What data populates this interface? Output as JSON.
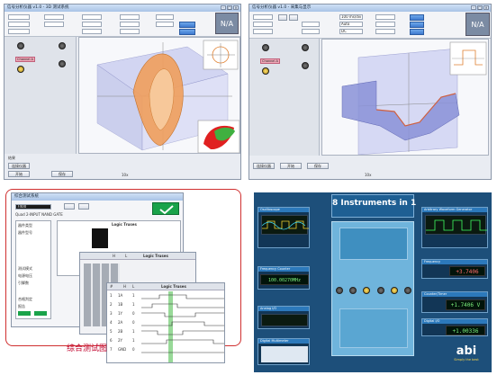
{
  "quadrants": {
    "q1": {
      "title": "信号分析仪器 v1.0 - 3D 测试系统",
      "na_label": "N/A",
      "channel_label": "Channel A",
      "status_label": "结果",
      "bottom_buttons": [
        "连接仪器",
        "开始",
        "保存"
      ],
      "bottom_tail": "10x"
    },
    "q2": {
      "title": "信号分析仪器 v1.0 - 采集与显示",
      "na_label": "N/A",
      "channel_label": "Channel A",
      "field_values": [
        "100 ms/div",
        "Auto",
        "DC"
      ],
      "bottom_buttons": [
        "连接仪器",
        "开始",
        "保存"
      ],
      "bottom_tail": "10x"
    },
    "q3": {
      "title": "综合测试系统",
      "field_value": "7400",
      "sub_label": "Quad 2-INPUT NAND GATE",
      "logic_header": "Logic Truses",
      "col_headers": [
        "#",
        "H",
        "L"
      ],
      "rows": [
        [
          "1",
          "1A",
          "1"
        ],
        [
          "2",
          "1B",
          "1"
        ],
        [
          "3",
          "1Y",
          "0"
        ],
        [
          "4",
          "2A",
          "0"
        ],
        [
          "5",
          "2B",
          "1"
        ],
        [
          "6",
          "2Y",
          "1"
        ],
        [
          "7",
          "GND",
          "0"
        ]
      ],
      "left_list": [
        "器件类型",
        "器件型号",
        "测试模式",
        "电源电压",
        "引脚数",
        "合格判定",
        "报告"
      ],
      "pass_label": "PASS",
      "caption": "综合测试图"
    },
    "q4": {
      "banner": "8 Instruments in 1",
      "panels_left": [
        "Oscilloscope",
        "Frequency Counter",
        "Analog I/O",
        "Digital Multimeter"
      ],
      "panels_right": [
        "Arbitrary Waveform Generator",
        "Frequency",
        "Counter/Timer",
        "Digital I/O"
      ],
      "freq_readout": "100.00270MHz",
      "right_readouts": [
        "+3.7406",
        "+1.7406 V",
        "+1.00336"
      ],
      "brand": "abi",
      "tagline": "Simply the best"
    }
  }
}
